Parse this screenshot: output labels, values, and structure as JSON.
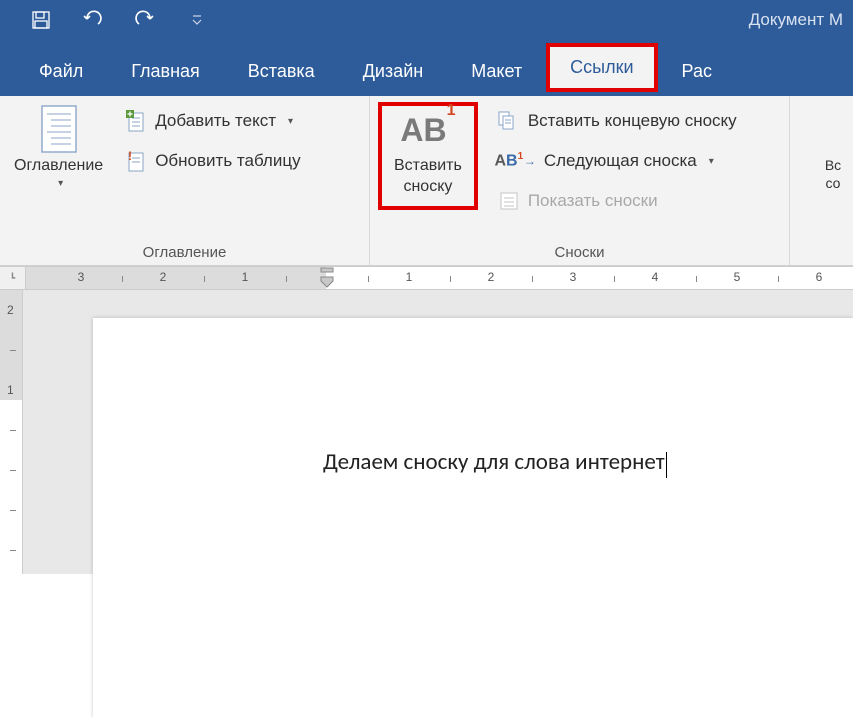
{
  "titlebar": {
    "document_title": "Документ M"
  },
  "tabs": {
    "file": "Файл",
    "home": "Главная",
    "insert": "Вставка",
    "design": "Дизайн",
    "layout": "Макет",
    "references": "Ссылки",
    "mailings": "Рас"
  },
  "ribbon": {
    "toc_group": {
      "label": "Оглавление",
      "toc_btn": "Оглавление",
      "add_text": "Добавить текст",
      "update_table": "Обновить таблицу"
    },
    "footnotes_group": {
      "label": "Сноски",
      "insert_footnote_line1": "Вставить",
      "insert_footnote_line2": "сноску",
      "insert_endnote": "Вставить концевую сноску",
      "next_footnote": "Следующая сноска",
      "show_notes": "Показать сноски"
    },
    "research_group": {
      "line1": "Вс",
      "line2": "со"
    }
  },
  "ruler_h": {
    "nums": [
      "3",
      "2",
      "1",
      "1",
      "2",
      "3",
      "4",
      "5",
      "6"
    ]
  },
  "ruler_v": {
    "nums": [
      "2",
      "1"
    ]
  },
  "document": {
    "text": "Делаем сноску для слова интернет"
  }
}
